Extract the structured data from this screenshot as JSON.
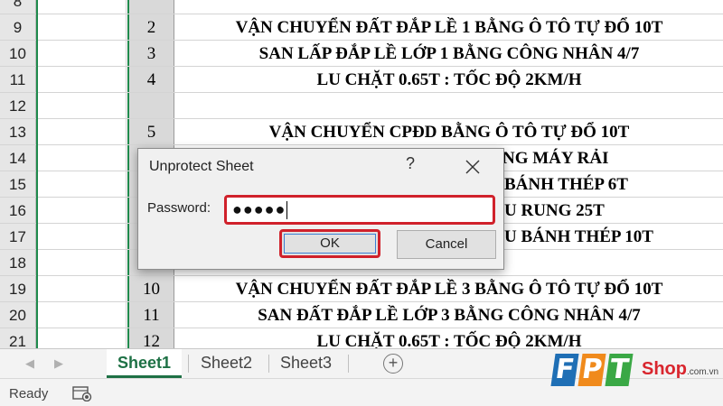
{
  "sheet": {
    "rows": [
      {
        "num": "8",
        "stt": "",
        "text": ""
      },
      {
        "num": "9",
        "stt": "2",
        "text": "VẬN CHUYỂN ĐẤT ĐẮP LỀ 1 BẰNG Ô TÔ TỰ ĐỔ 10T"
      },
      {
        "num": "10",
        "stt": "3",
        "text": "SAN LẤP ĐẮP LỀ LỚP 1 BẰNG CÔNG NHÂN 4/7"
      },
      {
        "num": "11",
        "stt": "4",
        "text": "LU CHẶT 0.65T : TỐC ĐỘ 2KM/H"
      },
      {
        "num": "12",
        "stt": "",
        "text": ""
      },
      {
        "num": "13",
        "stt": "5",
        "text": "VẬN CHUYỂN CPĐD BẰNG Ô TÔ TỰ ĐỔ 10T"
      },
      {
        "num": "14",
        "stt": "",
        "text": "NG MÁY RẢI"
      },
      {
        "num": "15",
        "stt": "",
        "text": "BÁNH THÉP 6T"
      },
      {
        "num": "16",
        "stt": "",
        "text": "U RUNG 25T"
      },
      {
        "num": "17",
        "stt": "",
        "text": "U BÁNH THÉP 10T"
      },
      {
        "num": "18",
        "stt": "",
        "text": ""
      },
      {
        "num": "19",
        "stt": "10",
        "text": "VẬN CHUYỂN ĐẤT ĐẮP LỀ 3 BẰNG Ô TÔ TỰ ĐỔ 10T"
      },
      {
        "num": "20",
        "stt": "11",
        "text": "SAN ĐẤT ĐẮP LỀ LỚP 3 BẰNG CÔNG NHÂN 4/7"
      },
      {
        "num": "21",
        "stt": "12",
        "text": "LU CHẶT 0.65T : TỐC ĐỘ 2KM/H"
      }
    ]
  },
  "tabs": [
    "Sheet1",
    "Sheet2",
    "Sheet3"
  ],
  "active_tab": "Sheet1",
  "status": {
    "ready": "Ready"
  },
  "dialog": {
    "title": "Unprotect Sheet",
    "help": "?",
    "password_label": "Password:",
    "password_value": "●●●●●",
    "ok": "OK",
    "cancel": "Cancel"
  },
  "logo": {
    "brand": "FPT",
    "shop": "Shop",
    "domain": ".com.vn"
  },
  "colors": {
    "accent_green": "#1e7145",
    "highlight_red": "#d0212b",
    "fpt_blue": "#1f6fb5",
    "fpt_orange": "#f08a1c",
    "fpt_green": "#3aa845"
  },
  "icons": {
    "macro": "macro-record-icon",
    "close": "close-icon",
    "add": "add-sheet-icon"
  }
}
